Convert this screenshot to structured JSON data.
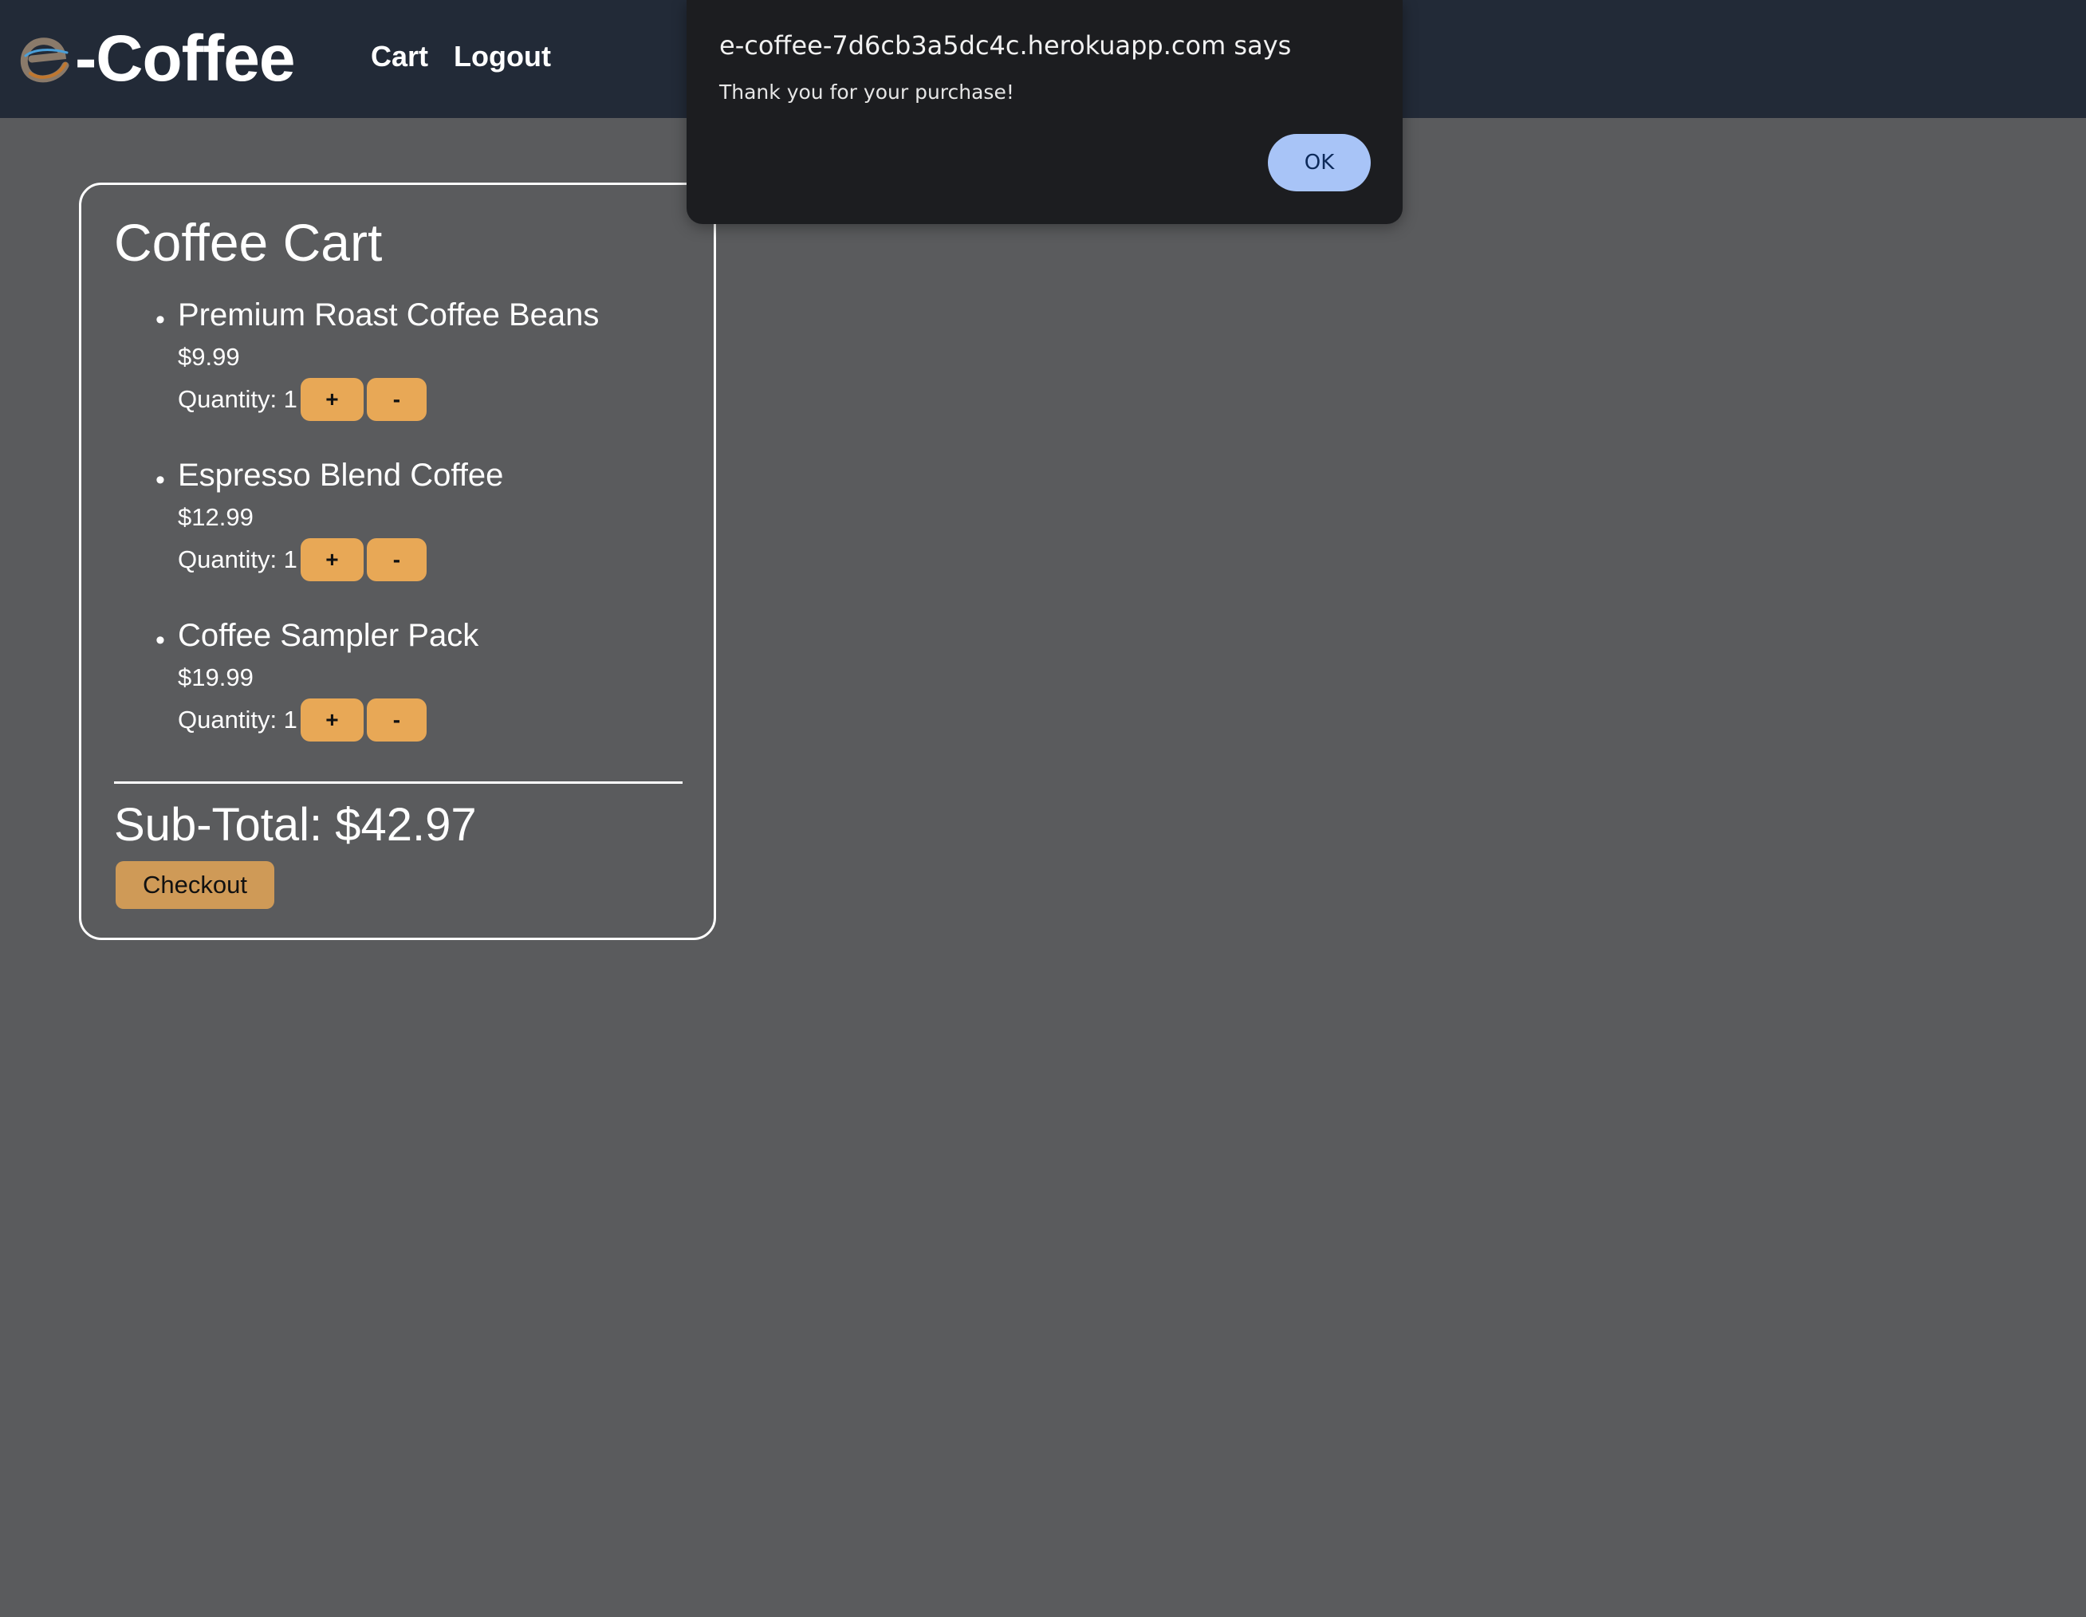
{
  "header": {
    "brand_text": "-Coffee",
    "nav": [
      {
        "label": "Cart"
      },
      {
        "label": "Logout"
      }
    ]
  },
  "cart": {
    "title": "Coffee Cart",
    "items": [
      {
        "name": "Premium Roast Coffee Beans",
        "price": "$9.99",
        "quantity_text": "Quantity: 1",
        "plus_label": "+",
        "minus_label": "-"
      },
      {
        "name": "Espresso Blend Coffee",
        "price": "$12.99",
        "quantity_text": "Quantity: 1",
        "plus_label": "+",
        "minus_label": "-"
      },
      {
        "name": "Coffee Sampler Pack",
        "price": "$19.99",
        "quantity_text": "Quantity: 1",
        "plus_label": "+",
        "minus_label": "-"
      }
    ],
    "subtotal": "Sub-Total: $42.97",
    "checkout_label": "Checkout"
  },
  "dialog": {
    "title": "e-coffee-7d6cb3a5dc4c.herokuapp.com says",
    "message": "Thank you for your purchase!",
    "ok_label": "OK"
  },
  "colors": {
    "page_bg": "#5a5b5d",
    "header_bg": "#222a37",
    "qty_button": "#e8a856",
    "checkout_button": "#cf9a57",
    "dialog_bg": "#1c1d20",
    "dialog_ok": "#a8c4f7"
  }
}
